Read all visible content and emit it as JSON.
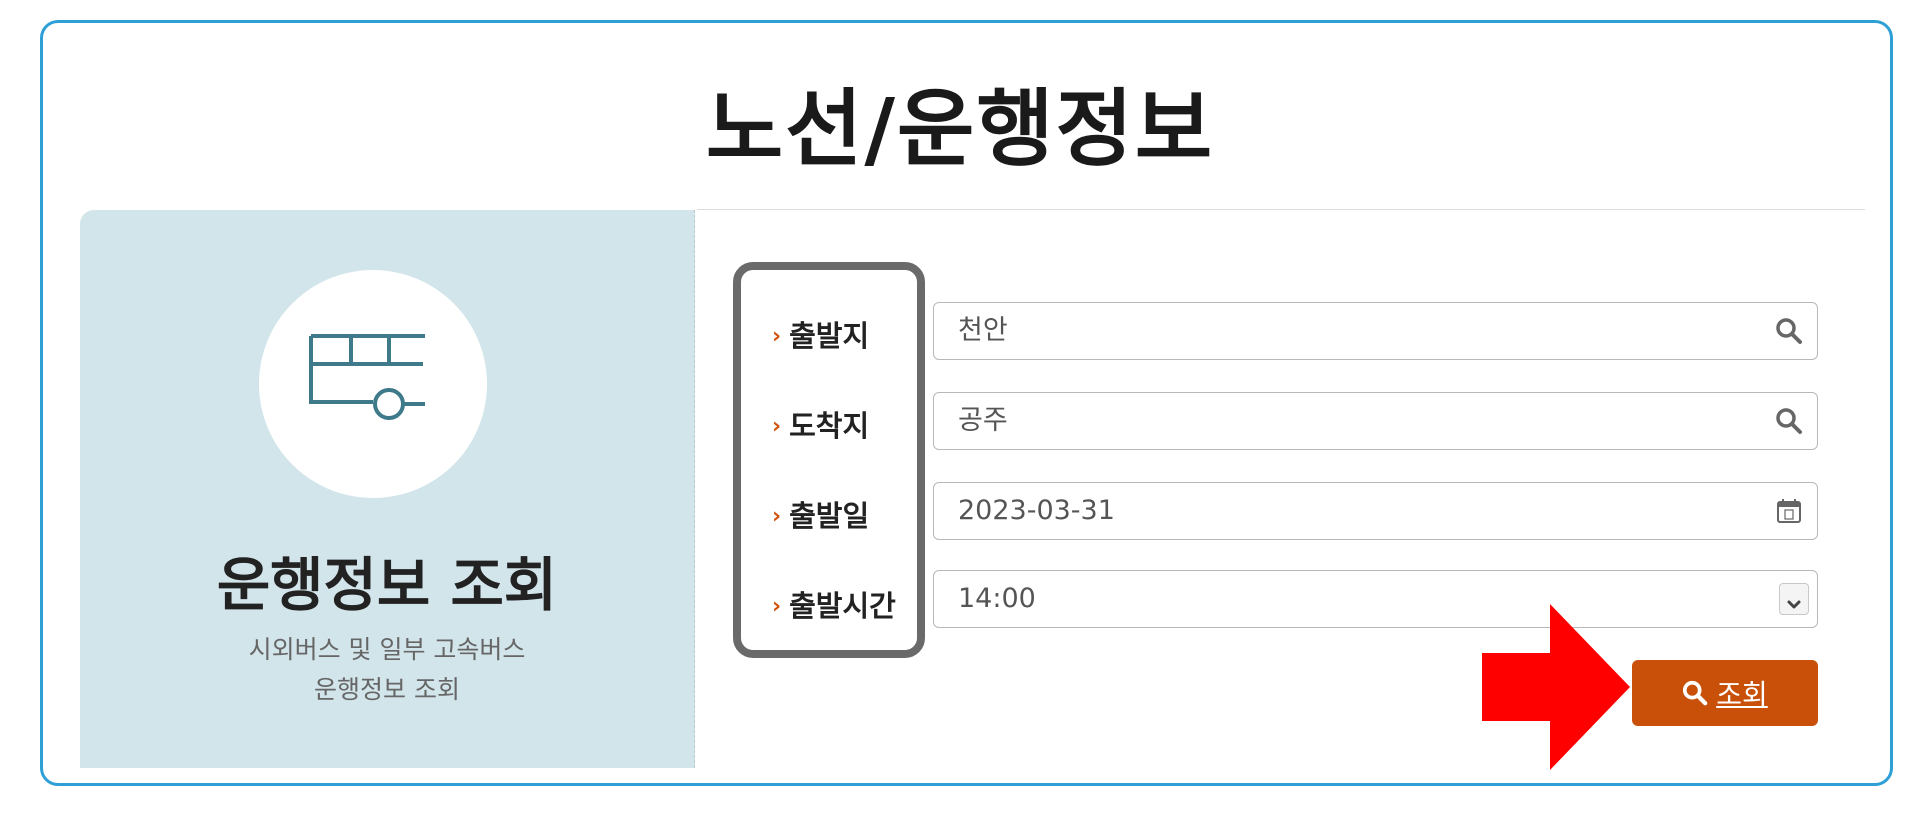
{
  "page": {
    "title": "노선/운행정보"
  },
  "panel": {
    "icon": "bus-icon",
    "title": "운행정보 조회",
    "desc_line1": "시외버스 및 일부 고속버스",
    "desc_line2": "운행정보 조회"
  },
  "form": {
    "departure": {
      "label": "출발지",
      "value": "천안",
      "icon": "search-icon"
    },
    "arrival": {
      "label": "도착지",
      "value": "공주",
      "icon": "search-icon"
    },
    "date": {
      "label": "출발일",
      "value": "2023-03-31",
      "icon": "calendar-icon"
    },
    "time": {
      "label": "출발시간",
      "value": "14:00",
      "icon": "chevron-down-icon"
    },
    "submit_label": "조회",
    "submit_icon": "search-icon"
  },
  "colors": {
    "frame_border": "#2ea0d6",
    "panel_bg": "#d2e5eb",
    "accent": "#c85008",
    "annotation_arrow": "#ff0000",
    "annotation_box": "#6a6a6a"
  }
}
